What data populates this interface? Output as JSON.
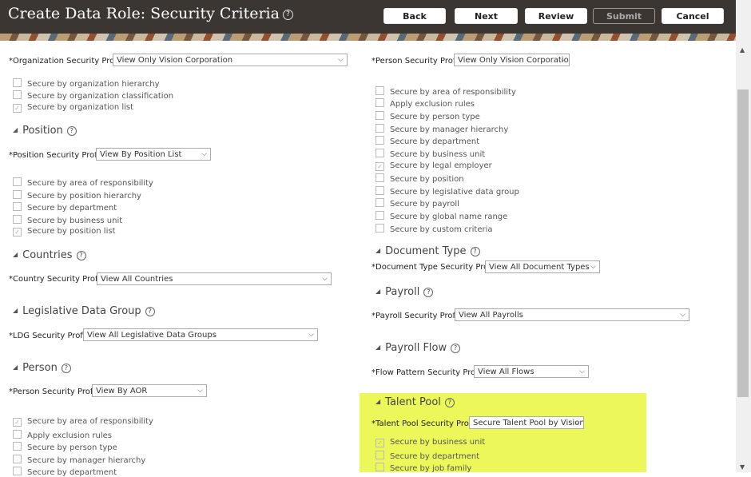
{
  "header": {
    "title": "Create Data Role: Security Criteria",
    "help": "?",
    "buttons": {
      "back": "Back",
      "next": "Next",
      "review": "Review",
      "submit": "Submit",
      "cancel": "Cancel"
    }
  },
  "left": {
    "org_profile_label": "*Organization Security Profile",
    "org_profile_value": "View Only Vision Corporation",
    "org_options": [
      "Secure by organization hierarchy",
      "Secure by organization classification",
      "Secure by organization list"
    ],
    "position_title": "Position",
    "position_profile_label": "*Position Security Profile",
    "position_profile_value": "View By Position List",
    "position_options": [
      "Secure by area of responsibility",
      "Secure by position hierarchy",
      "Secure by department",
      "Secure by business unit",
      "Secure by position list"
    ],
    "countries_title": "Countries",
    "country_profile_label": "*Country Security Profile",
    "country_profile_value": "View All Countries",
    "ldg_title": "Legislative Data Group",
    "ldg_profile_label": "*LDG Security Profile",
    "ldg_profile_value": "View All Legislative Data Groups",
    "person_title": "Person",
    "person_profile_label": "*Person Security Profile",
    "person_profile_value": "View By AOR",
    "person_options": [
      "Secure by area of responsibility",
      "Apply exclusion rules",
      "Secure by person type",
      "Secure by manager hierarchy",
      "Secure by department"
    ]
  },
  "right": {
    "person_profile_label": "*Person Security Profile",
    "person_profile_value": "View Only Vision Corporatio",
    "person_options": [
      "Secure by area of responsibility",
      "Apply exclusion rules",
      "Secure by person type",
      "Secure by manager hierarchy",
      "Secure by department",
      "Secure by business unit",
      "Secure by legal employer",
      "Secure by position",
      "Secure by legislative data group",
      "Secure by payroll",
      "Secure by global name range",
      "Secure by custom criteria"
    ],
    "doc_title": "Document Type",
    "doc_profile_label": "*Document Type Security Profile",
    "doc_profile_value": "View All Document Types",
    "payroll_title": "Payroll",
    "payroll_profile_label": "*Payroll Security Profile",
    "payroll_profile_value": "View All Payrolls",
    "flow_title": "Payroll Flow",
    "flow_profile_label": "*Flow Pattern Security Profile",
    "flow_profile_value": "View All Flows",
    "talent_title": "Talent Pool",
    "talent_profile_label": "*Talent Pool Security Profile",
    "talent_profile_value": "Secure Talent Pool by Vision",
    "talent_options": [
      "Secure by business unit",
      "Secure by department",
      "Secure by job family"
    ]
  },
  "check_mark": "✓",
  "chevron": "⌵",
  "triangle": "◢"
}
